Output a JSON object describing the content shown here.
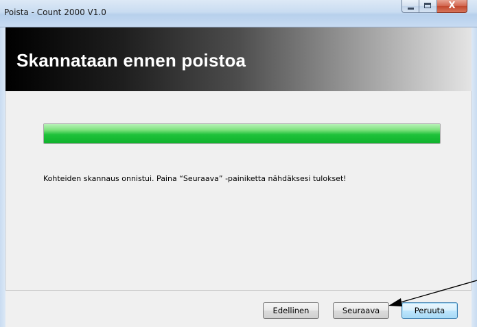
{
  "window": {
    "title": "Poista - Count 2000 V1.0",
    "controls": {
      "minimize": "minimize-icon",
      "maximize": "maximize-icon",
      "close": "close-icon",
      "close_glyph": "X"
    }
  },
  "header": {
    "title": "Skannataan ennen poistoa"
  },
  "progress": {
    "fraction": 1.0,
    "color": "#1fc23a"
  },
  "message": {
    "text": "Kohteiden skannaus onnistui. Paina “Seuraava” -painiketta nähdäksesi tulokset!"
  },
  "footer": {
    "prev_label": "Edellinen",
    "next_label": "Seuraava",
    "cancel_label": "Peruuta"
  },
  "colors": {
    "header_start": "#000000",
    "header_end": "#e4e4e4",
    "default_button_border": "#3c7fb1"
  }
}
